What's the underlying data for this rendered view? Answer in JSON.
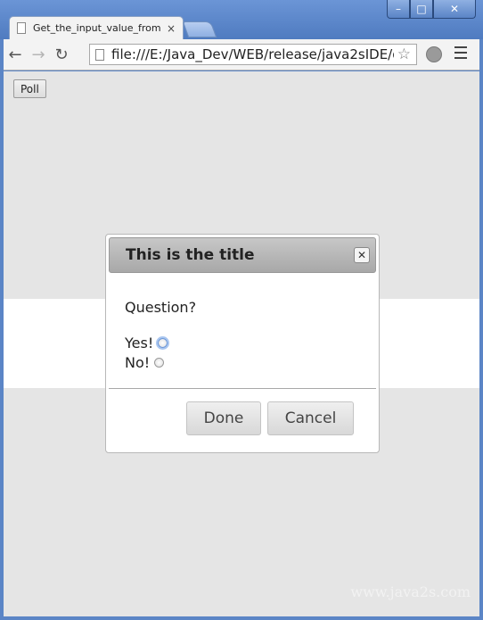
{
  "browser": {
    "tab_title": "Get_the_input_value_from",
    "tab_close": "×",
    "url": "file:///E:/Java_Dev/WEB/release/java2sIDE/gen",
    "back": "←",
    "forward": "→",
    "reload": "↻",
    "star": "☆",
    "window_buttons": {
      "minimize": "–",
      "maximize": "□",
      "close": "✕"
    }
  },
  "page": {
    "poll_label": "Poll",
    "watermark": "www.java2s.com"
  },
  "dialog": {
    "title": "This is the title",
    "close": "✕",
    "question": "Question?",
    "options": [
      {
        "label": "Yes!",
        "checked": false,
        "focused": true
      },
      {
        "label": "No!",
        "checked": false,
        "focused": false
      }
    ],
    "done_label": "Done",
    "cancel_label": "Cancel"
  }
}
